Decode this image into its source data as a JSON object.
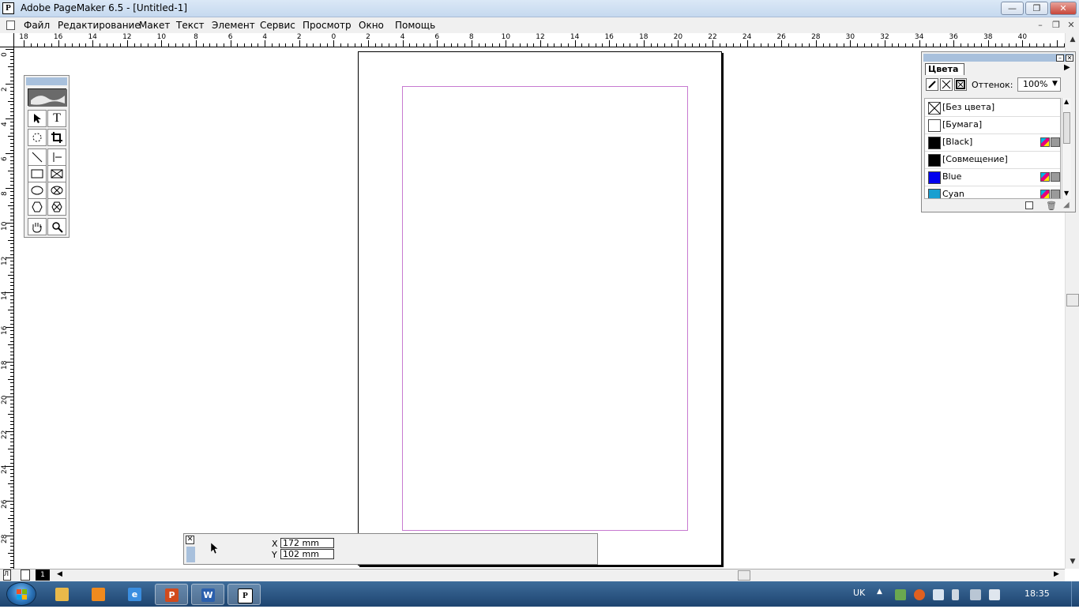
{
  "window": {
    "title": "Adobe PageMaker 6.5 - [Untitled-1]",
    "app_icon_letter": "P",
    "minimize_glyph": "—",
    "maximize_glyph": "❐",
    "close_glyph": "✕"
  },
  "menubar": {
    "items": [
      "Файл",
      "Редактирование",
      "Макет",
      "Текст",
      "Элемент",
      "Сервис",
      "Просмотр",
      "Окно",
      "Помощь"
    ],
    "mdi_minimize": "–",
    "mdi_restore": "❐",
    "mdi_close": "✕"
  },
  "rulers": {
    "horizontal_labels": [
      "18",
      "16",
      "14",
      "12",
      "10",
      "8",
      "6",
      "4",
      "2",
      "0",
      "2",
      "4",
      "6",
      "8",
      "10",
      "12",
      "14",
      "16",
      "18",
      "20",
      "22",
      "24",
      "26",
      "28",
      "30",
      "32",
      "34",
      "36",
      "38",
      "40"
    ],
    "vertical_labels": [
      "0",
      "2",
      "4",
      "6",
      "8",
      "10",
      "12",
      "14",
      "16",
      "18",
      "20",
      "22",
      "24",
      "26",
      "28"
    ]
  },
  "toolbox": {
    "tools": [
      {
        "name": "pointer-tool-icon"
      },
      {
        "name": "text-tool-icon",
        "glyph": "T"
      },
      {
        "name": "rotate-tool-icon"
      },
      {
        "name": "crop-tool-icon"
      },
      {
        "name": "line-tool-icon"
      },
      {
        "name": "constrained-line-tool-icon"
      },
      {
        "name": "rectangle-tool-icon"
      },
      {
        "name": "rectangle-frame-tool-icon"
      },
      {
        "name": "ellipse-tool-icon"
      },
      {
        "name": "ellipse-frame-tool-icon"
      },
      {
        "name": "polygon-tool-icon"
      },
      {
        "name": "polygon-frame-tool-icon"
      },
      {
        "name": "hand-tool-icon"
      },
      {
        "name": "zoom-tool-icon"
      }
    ]
  },
  "colors_panel": {
    "tab_label": "Цвета",
    "tint_label": "Оттенок:",
    "tint_value": "100%",
    "colors": [
      {
        "name": "[Без цвета]",
        "swatch": "none"
      },
      {
        "name": "[Бумага]",
        "swatch": "#ffffff"
      },
      {
        "name": "[Black]",
        "swatch": "#000000",
        "icons": true
      },
      {
        "name": "[Совмещение]",
        "swatch": "#000000"
      },
      {
        "name": "Blue",
        "swatch": "#0000ee",
        "icons": true
      },
      {
        "name": "Cyan",
        "swatch": "#1a9fd0",
        "icons": true
      }
    ]
  },
  "control_palette": {
    "x_label": "X",
    "x_value": "172 mm",
    "y_label": "Y",
    "y_value": "102 mm"
  },
  "bottom": {
    "left_page_label": "Л",
    "current_page": "1"
  },
  "taskbar": {
    "apps": [
      {
        "name": "explorer",
        "color": "#e9b94a",
        "glyph": ""
      },
      {
        "name": "media-player",
        "color": "#f08a1e",
        "glyph": ""
      },
      {
        "name": "internet-explorer",
        "color": "#3a8ee0",
        "glyph": "e"
      },
      {
        "name": "powerpoint",
        "color": "#d14a1c",
        "glyph": "P"
      },
      {
        "name": "word",
        "color": "#2b5fad",
        "glyph": "W"
      },
      {
        "name": "pagemaker",
        "color": "#ffffff",
        "glyph": "P"
      }
    ],
    "language": "UK",
    "clock": "18:35"
  }
}
